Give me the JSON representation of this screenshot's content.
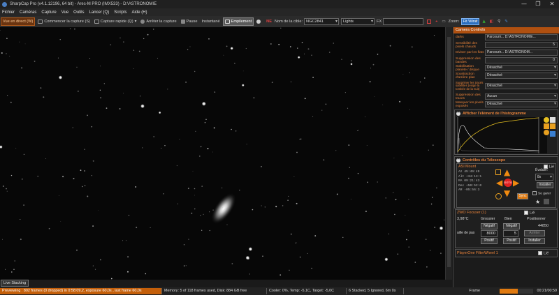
{
  "window": {
    "title": "SharpCap Pro (v4.1.12196, 64 bit) - Ares-M PRO (IMX533) - D:\\ASTRONOMIE",
    "minimize": "—",
    "maximize": "❐",
    "close": "✕"
  },
  "menu": [
    "Fichier",
    "Caméras",
    "Capture",
    "Vue",
    "Outils",
    "Lancer (Q)",
    "Scripts",
    "Aide (H)"
  ],
  "toolbar": {
    "live": "Vue en direct (W)",
    "start_capture": "Commencer la capture (S)",
    "quick_capture": "Capture rapide (Q)",
    "stop_capture": "Arrêter la capture",
    "pause": "Pause",
    "snapshot": "Instantané",
    "stacking": "Empilement",
    "target_label": "Nom de la cible:",
    "target_value": "NGC2841",
    "frame_type": "Lights",
    "fx_label": "FX",
    "fx_value": "",
    "zoom_label": "Zoom:",
    "zoom_value": "Fit Wind"
  },
  "viewer": {
    "live_tab": "Live Stacking"
  },
  "panel": {
    "header": "Camera Controls",
    "rows": [
      {
        "label": "darks",
        "value": "Parcourir... D:\\ASTRONOMIE..."
      },
      {
        "label": "Sensibilité des pixels chauds",
        "value": "5"
      },
      {
        "label": "Diviser par les flats",
        "value": "Parcourir... D:\\ASTRONOM..."
      },
      {
        "label": "Suppression des bandes",
        "value": "0"
      },
      {
        "label": "Stabilisation planète / disque",
        "value": "Désactivé"
      },
      {
        "label": "Soustraction d'arrière plan",
        "value": "Désactivé"
      },
      {
        "label": "Supprimer les tracés satellites (exige la tombée de la nuit)",
        "value": "Désactivé"
      },
      {
        "label": "Suppression des traces",
        "value": "Aucun"
      },
      {
        "label": "Masquer les pixels exposés",
        "value": "Désactivé"
      }
    ],
    "histogram": {
      "title": "Afficher l'élément de l'histogramme"
    },
    "telescope": {
      "title": "Contrôles du Télescope",
      "mount_name": "ASI Mount",
      "link": "Lié",
      "coords": [
        {
          "k": "Az",
          "v": "45:49:49"
        },
        {
          "k": "Alt",
          "v": "+34:13:1"
        },
        {
          "k": "RA",
          "v": "09:21:43"
        },
        {
          "k": "Dec",
          "v": "+50:52:0"
        },
        {
          "k": "AR",
          "v": "-05:56:3"
        }
      ],
      "evaluer_label": "Évaluer:",
      "rate": "8x",
      "install": "Installer",
      "goto": "GOTO",
      "sync": "Sync",
      "park": "Se garer"
    },
    "focuser": {
      "title": "ZWO Focuser (1)",
      "link": "Lié",
      "temp": "3,98°C",
      "coarse": "Grossier",
      "fine": "Bien",
      "position_label": "Positionner",
      "position": "44850",
      "step_label": "aille de pas",
      "negatif": "Négatif",
      "positif": "Positif",
      "coarse_step": "8000",
      "fine_step": "5",
      "stop": "Arrêter",
      "install": "Installer"
    },
    "filterwheel": {
      "title": "PlayerOne FilterWheel 1",
      "link": "Lié"
    }
  },
  "status": {
    "previewing": "Previewing : 802 frames (0 dropped) in 0:58:09,2, exposure 60,0s , last frame 60,0s",
    "memory": "Memory: 5 of 118 frames used, Disk: 884 GB free",
    "cooler": "Cooler: 0%, Temp: -5,1C, Target: -5,0C",
    "stacked": "6 Stacked, 5 Ignored, 6m 0s",
    "frame_label": "Frame",
    "frame_progress": 0.55,
    "time": "00:21/00:59"
  },
  "colors": {
    "accent_orange": "#e07a10",
    "panel_header": "#b05010",
    "zoom_blue": "#2c6fbf"
  }
}
